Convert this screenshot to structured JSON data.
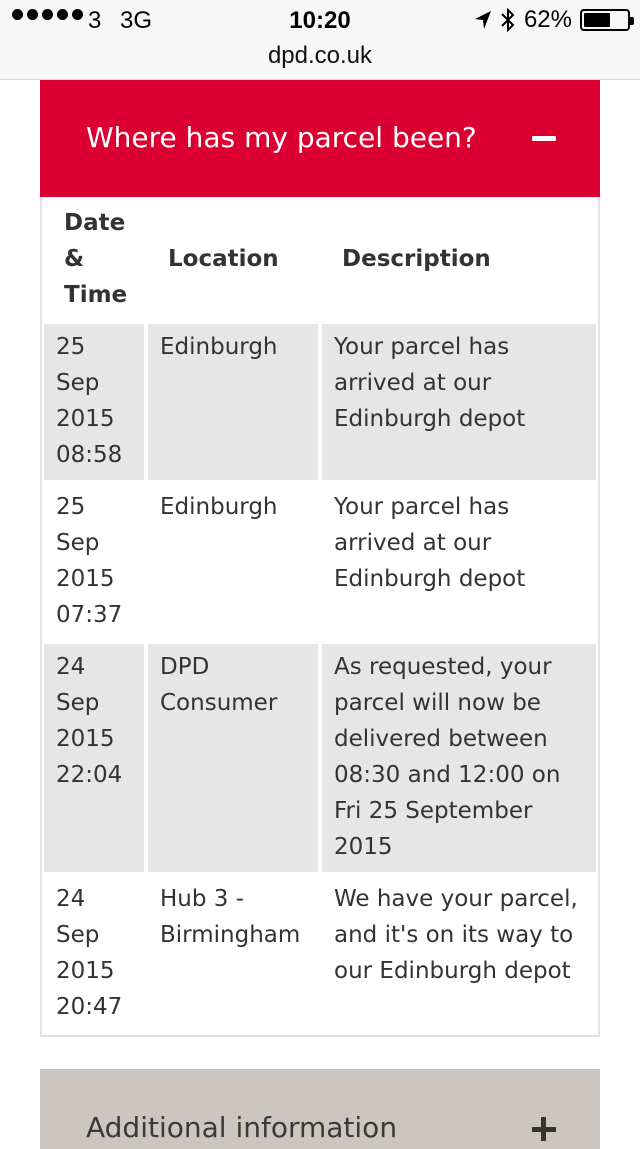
{
  "status_bar": {
    "carrier": "3",
    "network": "3G",
    "time": "10:20",
    "battery": "62%",
    "battery_level": 0.62
  },
  "browser": {
    "url": "dpd.co.uk"
  },
  "accordion": {
    "title": "Where has my parcel been?",
    "toggle_icon": "minus-icon",
    "accent_color": "#dc0032"
  },
  "table": {
    "headers": {
      "date_line1": "Date",
      "date_line2": "&",
      "date_line3": "Time",
      "location": "Location",
      "description": "Description"
    },
    "rows": [
      {
        "date": [
          "25",
          "Sep",
          "2015",
          "08:58"
        ],
        "location": [
          "Edinburgh"
        ],
        "description": [
          "Your parcel has",
          "arrived at our",
          "Edinburgh depot"
        ]
      },
      {
        "date": [
          "25",
          "Sep",
          "2015",
          "07:37"
        ],
        "location": [
          "Edinburgh"
        ],
        "description": [
          "Your parcel has",
          "arrived at our",
          "Edinburgh depot"
        ]
      },
      {
        "date": [
          "24",
          "Sep",
          "2015",
          "22:04"
        ],
        "location": [
          "DPD",
          "Consumer"
        ],
        "description": [
          "As requested, your",
          "parcel will now be",
          "delivered between",
          "08:30 and 12:00 on",
          "Fri 25 September",
          "2015"
        ]
      },
      {
        "date": [
          "24",
          "Sep",
          "2015",
          "20:47"
        ],
        "location": [
          "Hub 3 -",
          "Birmingham"
        ],
        "description": [
          "We have your parcel,",
          "and it's on its way to",
          "our Edinburgh depot"
        ]
      }
    ]
  },
  "additional": {
    "title": "Additional information",
    "toggle_icon": "plus-icon"
  }
}
